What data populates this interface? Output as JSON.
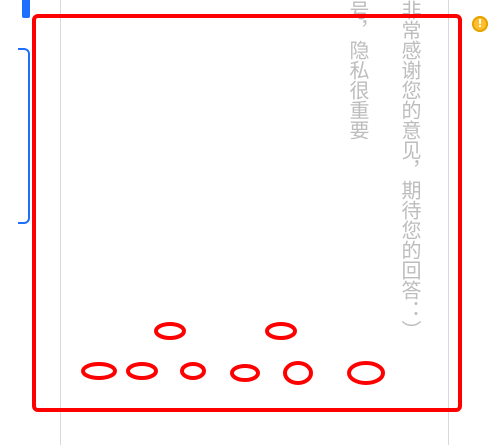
{
  "ui": {
    "vertical_text_col_1": "非常感谢您的意见，期待您的回答：）",
    "vertical_text_col_2": "号，隐私很重要",
    "warning_icon_glyph": "!"
  },
  "annotation": {
    "stroke": "#ff0000"
  }
}
